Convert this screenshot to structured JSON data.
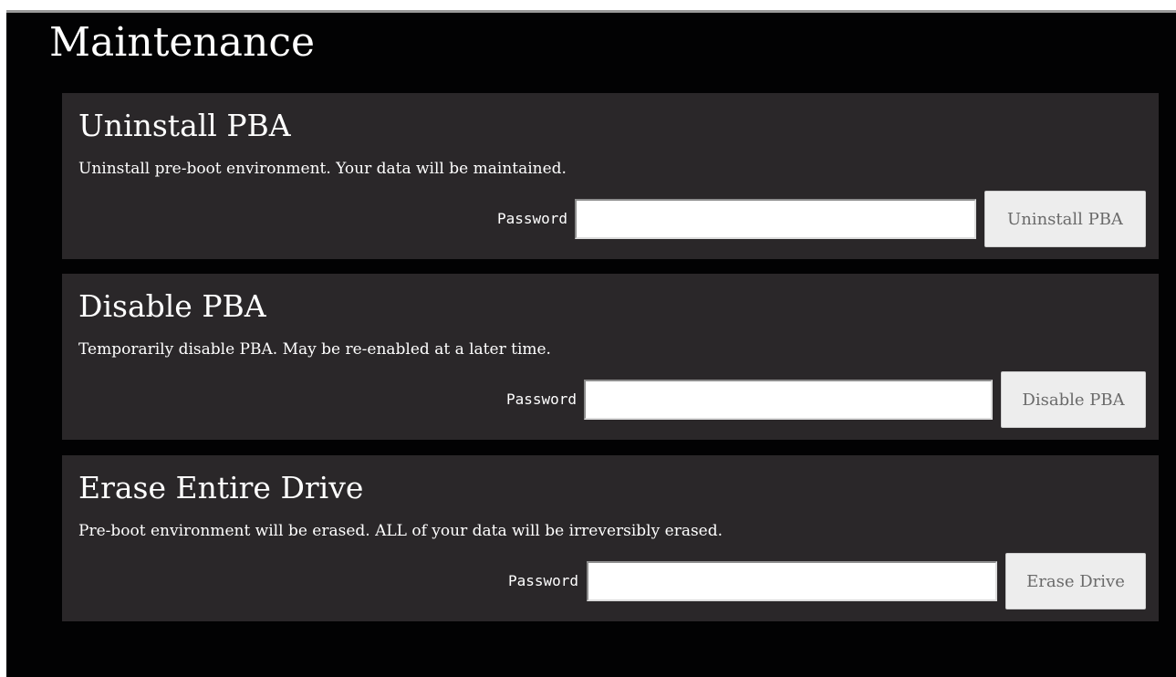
{
  "page": {
    "title": "Maintenance"
  },
  "sections": [
    {
      "title": "Uninstall PBA",
      "description": "Uninstall pre-boot environment. Your data will be maintained.",
      "password_label": "Password",
      "password_value": "",
      "button_label": "Uninstall PBA"
    },
    {
      "title": "Disable PBA",
      "description": "Temporarily disable PBA. May be re-enabled at a later time.",
      "password_label": "Password",
      "password_value": "",
      "button_label": "Disable PBA"
    },
    {
      "title": "Erase Entire Drive",
      "description": "Pre-boot environment will be erased. ALL of your data will be irreversibly erased.",
      "password_label": "Password",
      "password_value": "",
      "button_label": "Erase Drive"
    }
  ],
  "colors": {
    "background": "#020203",
    "panel": "#2a2729",
    "button": "#ededed",
    "button_text": "#6a6a6a",
    "text": "#ffffff"
  }
}
